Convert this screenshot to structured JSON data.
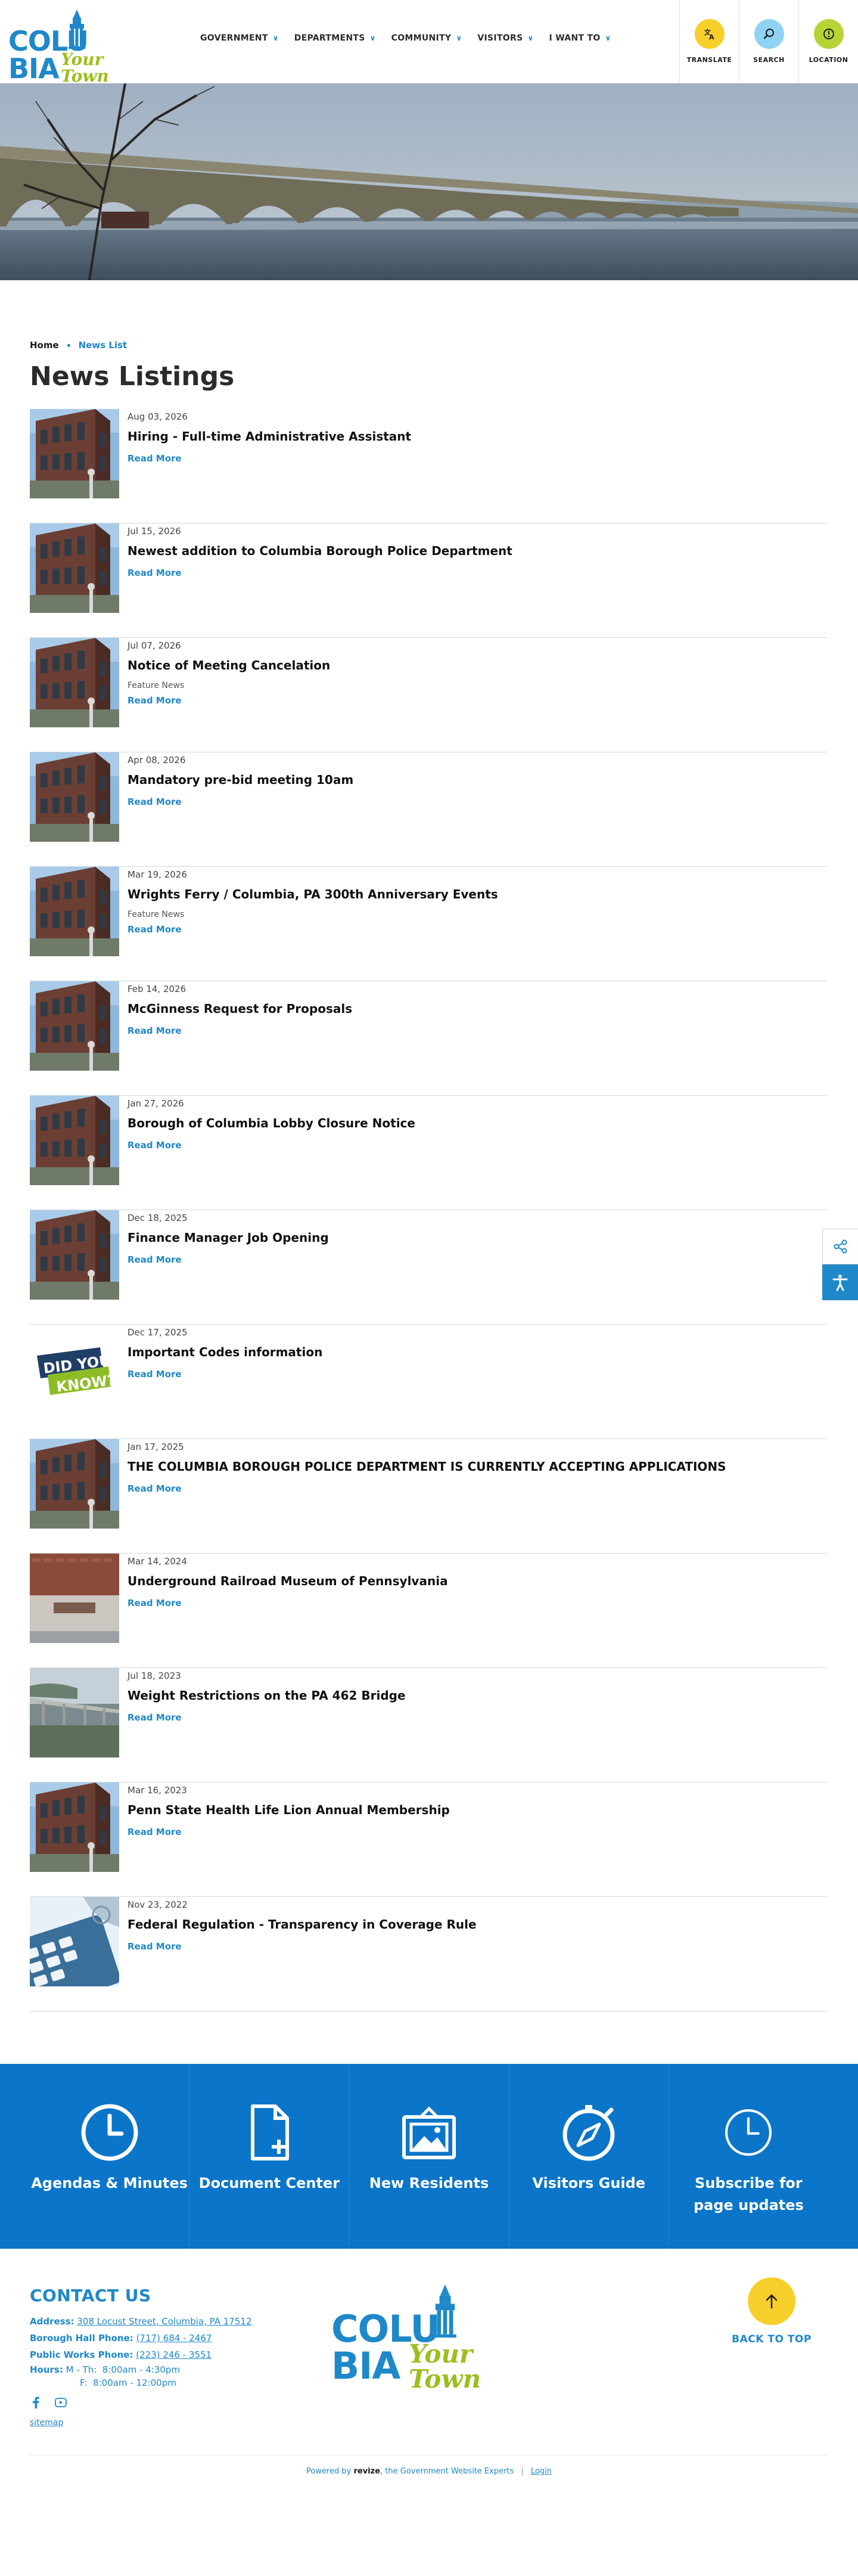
{
  "site": {
    "logo_word_left": "COLU",
    "logo_word_right": "BIA",
    "logo_script": "Your Town"
  },
  "nav": [
    {
      "label": "GOVERNMENT"
    },
    {
      "label": "DEPARTMENTS"
    },
    {
      "label": "COMMUNITY"
    },
    {
      "label": "VISITORS"
    },
    {
      "label": "I WANT TO"
    }
  ],
  "tools": [
    {
      "label": "TRANSLATE",
      "color": "#f7cf2a",
      "icon": "translate-icon"
    },
    {
      "label": "SEARCH",
      "color": "#8fd2f4",
      "icon": "search-icon"
    },
    {
      "label": "LOCATION",
      "color": "#b6d436",
      "icon": "location-icon"
    }
  ],
  "breadcrumb": {
    "home": "Home",
    "current": "News List"
  },
  "page_title": "News Listings",
  "news": [
    {
      "date": "Aug 03, 2026",
      "title": "Hiring - Full-time Administrative Assistant",
      "category": "",
      "more": "Read More",
      "thumb": "building"
    },
    {
      "date": "Jul 15, 2026",
      "title": "Newest addition to Columbia Borough Police Department",
      "category": "",
      "more": "Read More",
      "thumb": "building"
    },
    {
      "date": "Jul 07, 2026",
      "title": "Notice of Meeting Cancelation",
      "category": "Feature News",
      "more": "Read More",
      "thumb": "building"
    },
    {
      "date": "Apr 08, 2026",
      "title": "Mandatory pre-bid meeting 10am",
      "category": "",
      "more": "Read More",
      "thumb": "building"
    },
    {
      "date": "Mar 19, 2026",
      "title": "Wrights Ferry / Columbia, PA 300th Anniversary Events",
      "category": "Feature News",
      "more": "Read More",
      "thumb": "building"
    },
    {
      "date": "Feb 14, 2026",
      "title": "McGinness Request for Proposals",
      "category": "",
      "more": "Read More",
      "thumb": "building"
    },
    {
      "date": "Jan 27, 2026",
      "title": "Borough of Columbia Lobby Closure Notice",
      "category": "",
      "more": "Read More",
      "thumb": "building"
    },
    {
      "date": "Dec 18, 2025",
      "title": "Finance Manager Job Opening",
      "category": "",
      "more": "Read More",
      "thumb": "building"
    },
    {
      "date": "Dec 17, 2025",
      "title": "Important Codes information",
      "category": "",
      "more": "Read More",
      "thumb": "didyouknow"
    },
    {
      "date": "Jan 17, 2025",
      "title": "THE COLUMBIA BOROUGH POLICE DEPARTMENT IS CURRENTLY ACCEPTING APPLICATIONS",
      "category": "",
      "more": "Read More",
      "thumb": "building"
    },
    {
      "date": "Mar 14, 2024",
      "title": "Underground Railroad Museum of Pennsylvania",
      "category": "",
      "more": "Read More",
      "thumb": "museum"
    },
    {
      "date": "Jul 18, 2023",
      "title": "Weight Restrictions on the PA 462 Bridge",
      "category": "",
      "more": "Read More",
      "thumb": "bridge"
    },
    {
      "date": "Mar 16, 2023",
      "title": "Penn State Health Life Lion Annual Membership",
      "category": "",
      "more": "Read More",
      "thumb": "building"
    },
    {
      "date": "Nov 23, 2022",
      "title": "Federal Regulation - Transparency in Coverage Rule",
      "category": "",
      "more": "Read More",
      "thumb": "calculator"
    }
  ],
  "didyouknow": {
    "line1": "DID YOU",
    "line2": "KNOW?"
  },
  "quick_links": [
    {
      "label": "Agendas & Minutes",
      "icon": "clock-icon"
    },
    {
      "label": "Document Center",
      "icon": "document-add-icon"
    },
    {
      "label": "New Residents",
      "icon": "picture-icon"
    },
    {
      "label": "Visitors Guide",
      "icon": "compass-icon"
    },
    {
      "label": "Subscribe for page updates",
      "icon": "clock-outline-icon"
    }
  ],
  "footer": {
    "contact_title": "CONTACT US",
    "address_label": "Address:",
    "address": "308 Locust Street, Columbia, PA 17512",
    "borough_phone_label": "Borough Hall Phone:",
    "borough_phone": "(717) 684 - 2467",
    "works_phone_label": "Public Works Phone:",
    "works_phone": "(223) 246 - 3551",
    "hours_label": "Hours:",
    "hours_1": "M - Th:  8:00am - 4:30pm",
    "hours_2": "F:  8:00am - 12:00pm",
    "sitemap": "sitemap",
    "back_to_top": "BACK TO TOP",
    "powered_prefix": "Powered by",
    "powered_brand": "revize",
    "powered_suffix": ", the Government Website Experts",
    "login": "Login"
  },
  "colors": {
    "brand_blue": "#1e88c9",
    "quick_links_bg": "#0b75c9",
    "brand_green": "#9bbf1f",
    "accent_yellow": "#f7cf2a"
  }
}
